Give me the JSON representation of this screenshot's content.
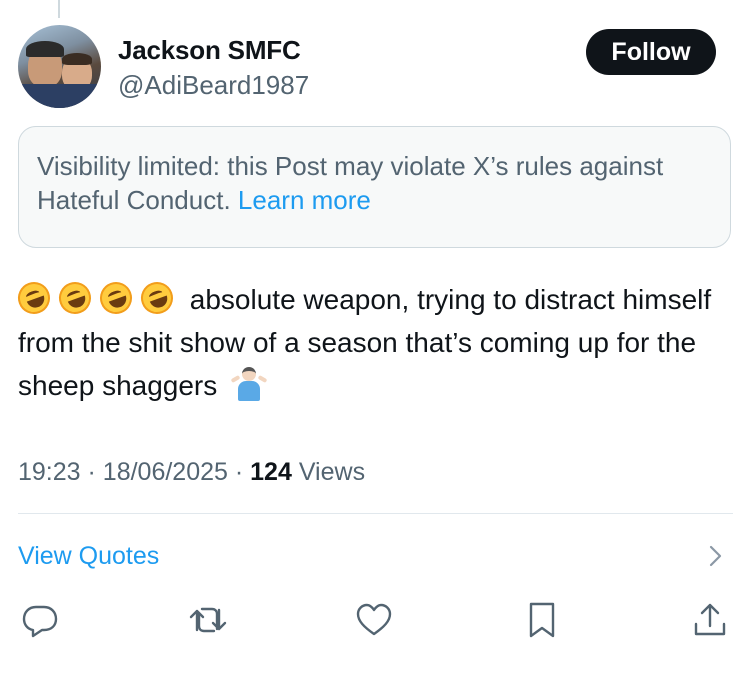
{
  "post": {
    "author_name": "Jackson SMFC",
    "author_handle": "@AdiBeard1987",
    "follow_label": "Follow",
    "notice": {
      "text": "Visibility limited: this Post may violate X’s rules against Hateful Conduct.",
      "link": "Learn more"
    },
    "text_emoji_prefix": [
      "face-with-tears-of-joy-rolling",
      "face-with-tears-of-joy-rolling",
      "face-with-tears-of-joy-rolling",
      "face-with-tears-of-joy-rolling"
    ],
    "text": "absolute weapon, trying to distract himself from the shit show of a season that’s coming up for the sheep shaggers",
    "text_emoji_suffix": "person-shrugging",
    "time": "19:23",
    "date": "18/06/2025",
    "views_count": "124",
    "views_label": "Views",
    "view_quotes_label": "View Quotes"
  },
  "icons": [
    "reply-icon",
    "repost-icon",
    "like-icon",
    "bookmark-icon",
    "share-icon",
    "chevron-right-icon"
  ],
  "colors": {
    "accent": "#1d9bf0",
    "text": "#0f1419",
    "muted": "#536471",
    "border": "#cfd9de",
    "notice_bg": "#f7f9f9"
  }
}
